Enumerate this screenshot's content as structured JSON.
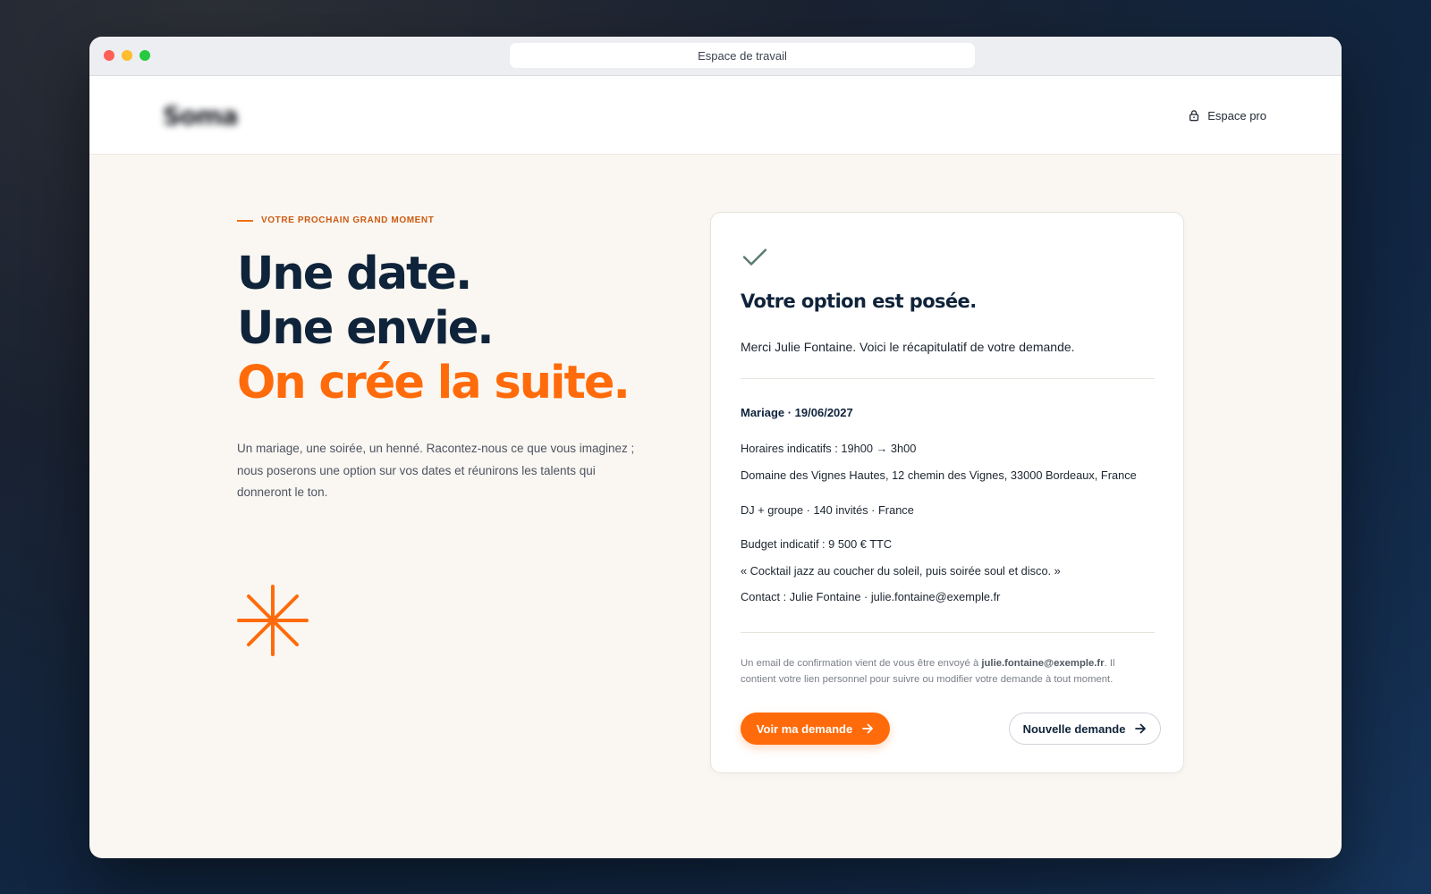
{
  "window": {
    "url_bar": "Espace de travail"
  },
  "header": {
    "logo_text": "Soma",
    "pro_link": "Espace pro"
  },
  "hero": {
    "eyebrow": "VOTRE PROCHAIN GRAND MOMENT",
    "headline_line1": "Une date.",
    "headline_line2": "Une envie.",
    "headline_line3": "On crée la suite.",
    "lead": "Un mariage, une soirée, un henné. Racontez-nous ce que vous imaginez ; nous poserons une option sur vos dates et réunirons les talents qui donneront le ton."
  },
  "confirmation": {
    "title": "Votre option est posée.",
    "subtitle": "Merci Julie Fontaine. Voici le récapitulatif de votre demande.",
    "event": "Mariage · 19/06/2027",
    "hours": "Horaires indicatifs : 19h00 → 3h00",
    "venue": "Domaine des Vignes Hautes, 12 chemin des Vignes, 33000 Bordeaux, France",
    "services": "DJ + groupe · 140 invités · France",
    "budget": "Budget indicatif : 9 500 € TTC",
    "quote": "« Cocktail jazz au coucher du soleil, puis soirée soul et disco. »",
    "contact": "Contact : Julie Fontaine · julie.fontaine@exemple.fr",
    "note_before": "Un email de confirmation vient de vous être envoyé à ",
    "note_email": "julie.fontaine@exemple.fr",
    "note_after": ". Il contient votre lien personnel pour suivre ou modifier votre demande à tout moment.",
    "primary_button": "Voir ma demande",
    "secondary_button": "Nouvelle demande"
  },
  "icons": {
    "pro": "lock-icon",
    "check": "check-icon",
    "decor": "asterisk-icon",
    "buttons": "arrow-right-icon"
  },
  "colors": {
    "accent": "#ff6b0a",
    "navy": "#0f233a",
    "background": "#faf7f2",
    "check": "#5a7a6e"
  }
}
